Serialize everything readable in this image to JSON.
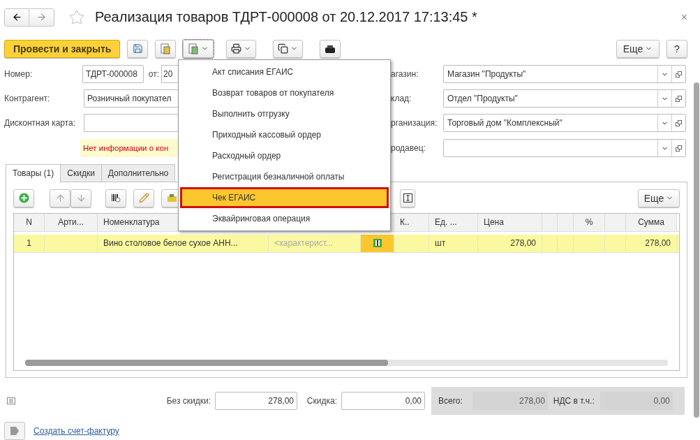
{
  "header": {
    "title": "Реализация товаров ТДРТ-000008 от 20.12.2017 17:13:45 *",
    "close": "×"
  },
  "toolbar": {
    "primary": "Провести и закрыть",
    "more": "Еще",
    "help": "?"
  },
  "form_left": {
    "number": {
      "label": "Номер:",
      "value": "ТДРТ-000008"
    },
    "date": {
      "label": "от:",
      "value": "20"
    },
    "counterparty": {
      "label": "Контрагент:",
      "value": "Розничный покупател"
    },
    "discount_card": {
      "label": "Дисконтная карта:"
    },
    "notice": "Нет информации о кон"
  },
  "form_right": [
    {
      "label": "агазин:",
      "value": "Магазин \"Продукты\""
    },
    {
      "label": "клад:",
      "value": "Отдел \"Продукты\""
    },
    {
      "label": "рганизация:",
      "value": "Торговый дом \"Комплексный\""
    },
    {
      "label": "родавец:"
    }
  ],
  "tabs": [
    {
      "label": "Товары (1)",
      "selected": true
    },
    {
      "label": "Скидки",
      "selected": false
    },
    {
      "label": "Дополнительно",
      "selected": false
    }
  ],
  "table_toolbar": {
    "more": "Еще"
  },
  "table": {
    "columns": [
      "N",
      "Арти...",
      "Номенклатура",
      "К..",
      "Ед. ...",
      "Цена",
      "%",
      "Сумма"
    ],
    "rows": [
      {
        "selected": true,
        "n": "1",
        "nomenclature": "Вино столовое белое сухое АНН...",
        "characteristic": "<характерист...",
        "unit": "шт",
        "price": "278,00",
        "sum": "278,00"
      }
    ]
  },
  "totals": {
    "no_discount": {
      "label": "Без скидки:",
      "value": "278,00"
    },
    "discount": {
      "label": "Скидка:",
      "value": "0,00"
    },
    "total": {
      "label": "Всего:",
      "value": "278,00"
    },
    "vat": {
      "label": "НДС в т.ч.:",
      "value": "0,00"
    }
  },
  "link": "Создать счет-фактуру",
  "menu": {
    "items": [
      {
        "label": "Акт списания ЕГАИС",
        "selected": false
      },
      {
        "label": "Возврат товаров от покупателя",
        "selected": false
      },
      {
        "label": "Выполнить отгрузку",
        "selected": false
      },
      {
        "label": "Приходный кассовый ордер",
        "selected": false
      },
      {
        "label": "Расходный ордер",
        "selected": false
      },
      {
        "label": "Регистрация безналичной оплаты",
        "selected": false
      },
      {
        "label": "Чек ЕГАИС",
        "selected": true
      },
      {
        "label": "Эквайринговая операция",
        "selected": false
      }
    ]
  }
}
